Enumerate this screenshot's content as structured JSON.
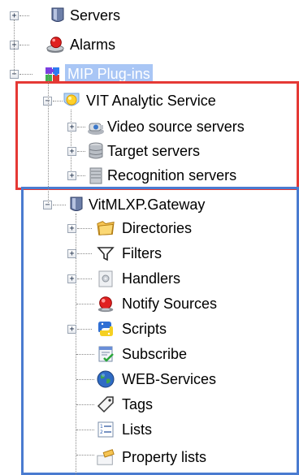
{
  "tree": {
    "root_items": [
      {
        "label": "Servers",
        "icon": "server-icon"
      },
      {
        "label": "Alarms",
        "icon": "alarm-icon"
      },
      {
        "label": "MIP Plug-ins",
        "icon": "plugin-puzzle-icon",
        "selected": true
      }
    ],
    "vit_service": {
      "label": "VIT Analytic Service",
      "icon": "shield-service-icon",
      "children": [
        {
          "label": "Video source servers",
          "icon": "camera-icon"
        },
        {
          "label": "Target servers",
          "icon": "database-icon"
        },
        {
          "label": "Recognition servers",
          "icon": "server-rack-icon"
        }
      ]
    },
    "gateway": {
      "label": "VitMLXP.Gateway",
      "icon": "gateway-shield-icon",
      "children": [
        {
          "label": "Directories",
          "icon": "folder-icon"
        },
        {
          "label": "Filters",
          "icon": "filter-icon"
        },
        {
          "label": "Handlers",
          "icon": "handlers-icon"
        },
        {
          "label": "Notify Sources",
          "icon": "notify-source-icon"
        },
        {
          "label": "Scripts",
          "icon": "python-icon"
        },
        {
          "label": "Subscribe",
          "icon": "subscribe-icon"
        },
        {
          "label": "WEB-Services",
          "icon": "globe-icon"
        },
        {
          "label": "Tags",
          "icon": "tag-icon"
        },
        {
          "label": "Lists",
          "icon": "list-icon"
        },
        {
          "label": "Property lists",
          "icon": "property-list-icon"
        }
      ]
    }
  },
  "colors": {
    "selection": "#a9c6f5",
    "red_frame": "#e53935",
    "blue_frame": "#4a7bd0"
  }
}
